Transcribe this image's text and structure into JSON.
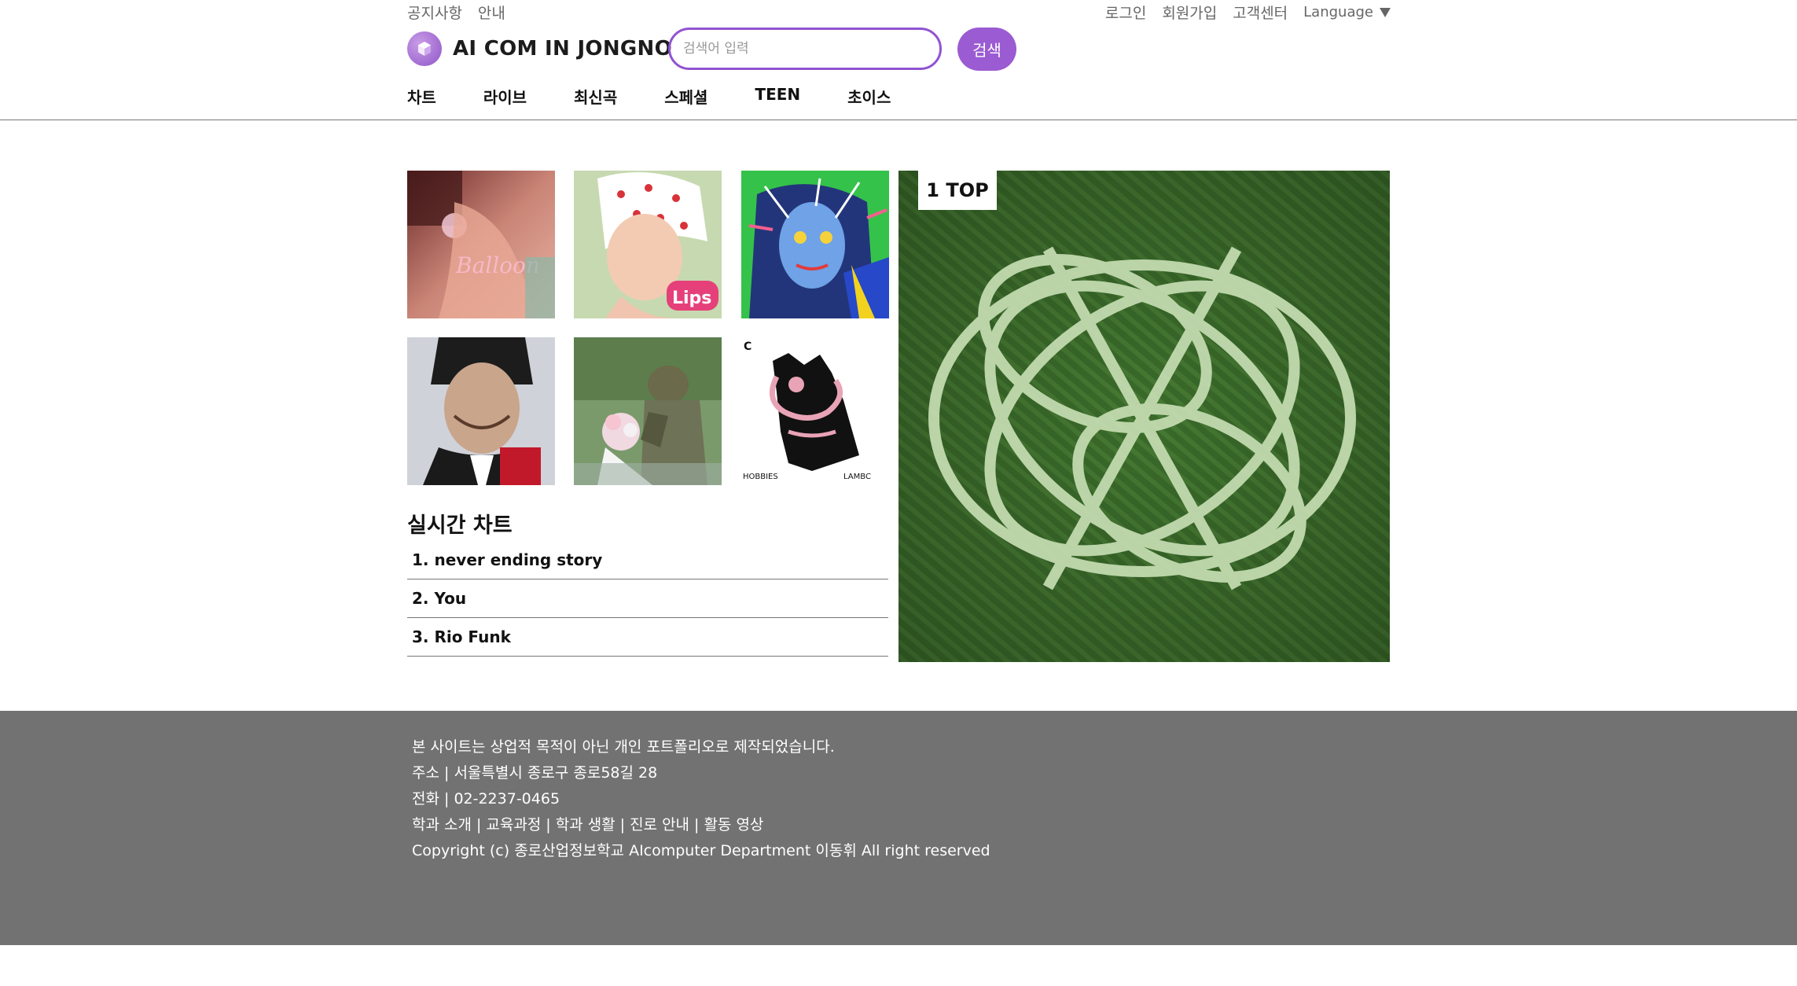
{
  "header": {
    "util_left": [
      "공지사항",
      "안내"
    ],
    "util_right": [
      "로그인",
      "회원가입",
      "고객센터"
    ],
    "language": "Language",
    "brand": "AI COM IN JONGNO",
    "search_placeholder": "검색어 입력",
    "search_button": "검색"
  },
  "nav": [
    "차트",
    "라이브",
    "최신곡",
    "스페셜",
    "TEEN",
    "초이스"
  ],
  "albums": [
    {
      "art": "balloon-album-cover"
    },
    {
      "art": "cherry-headscarf-cover"
    },
    {
      "art": "blue-face-illustration-cover"
    },
    {
      "art": "portrait-cover"
    },
    {
      "art": "flower-bouquet-soldier-cover"
    },
    {
      "art": "hobbies-black-figure-cover",
      "small_text": [
        "HOBBIES",
        "LAMBC"
      ]
    }
  ],
  "chart": {
    "title": "실시간 차트",
    "items": [
      "1. never ending story",
      "2. You",
      "3. Rio Funk"
    ]
  },
  "top": {
    "badge": "1 TOP",
    "art": "crop-circle-field"
  },
  "footer": {
    "notice": "본 사이트는 상업적 목적이 아닌 개인 포트폴리오로 제작되었습니다.",
    "address": "주소 | 서울특별시 종로구 종로58길 28",
    "phone": "전화 | 02-2237-0465",
    "links": [
      "학과 소개",
      "교육과정",
      "학과 생활",
      "진로 안내",
      "활동 영상"
    ],
    "link_separator": "|",
    "copyright": "Copyright (c) 종로산업정보학교 AIcomputer Department 이동휘 All right reserved"
  },
  "colors": {
    "accent": "#9b5bd2",
    "footer_bg": "#727272",
    "divider": "#777777"
  }
}
